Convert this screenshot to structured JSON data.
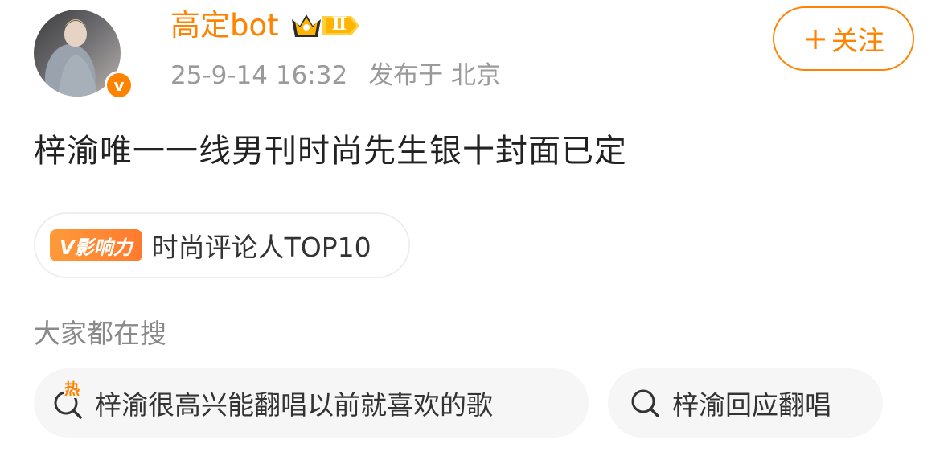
{
  "user": {
    "name": "高定bot",
    "level": "Ⅱ",
    "verified_mark": "v",
    "post_time": "25-9-14 16:32",
    "location": "发布于 北京"
  },
  "follow": {
    "plus": "+",
    "label": "关注"
  },
  "post": {
    "text": "梓渝唯一一线男刊时尚先生银十封面已定"
  },
  "influence": {
    "tag": "V影响力",
    "title": "时尚评论人TOP10"
  },
  "searches": {
    "title": "大家都在搜",
    "hot_label": "热",
    "items": [
      {
        "text": "梓渝很高兴能翻唱以前就喜欢的歌",
        "hot": true
      },
      {
        "text": "梓渝回应翻唱",
        "hot": false
      }
    ]
  },
  "colors": {
    "accent": "#ff8200",
    "text_primary": "#222222",
    "text_secondary": "#9a9a9a"
  }
}
